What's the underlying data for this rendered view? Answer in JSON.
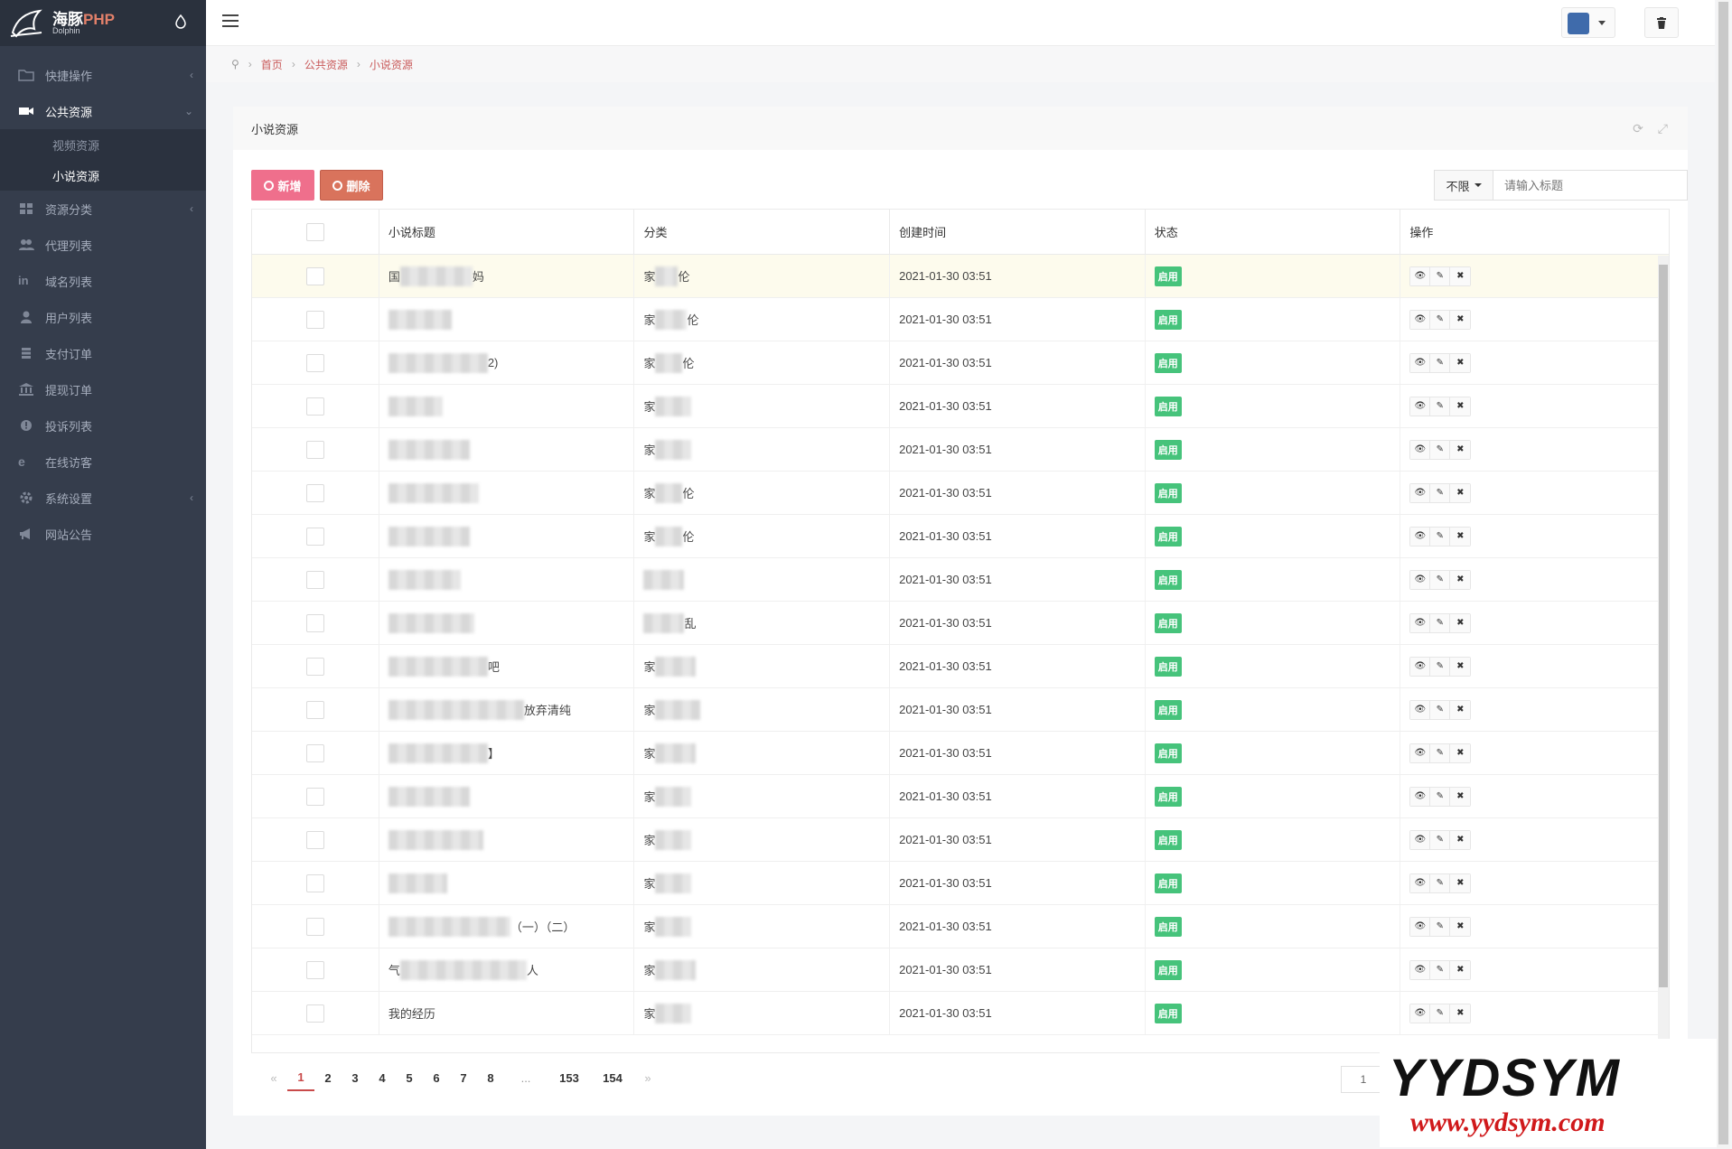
{
  "brand": {
    "name": "海豚",
    "name_suffix": "PHP",
    "sub": "Dolphin"
  },
  "sidebar": {
    "items": [
      {
        "label": "快捷操作",
        "has_arrow": true
      },
      {
        "label": "公共资源",
        "open": true
      },
      {
        "label": "资源分类",
        "has_arrow": true
      },
      {
        "label": "代理列表"
      },
      {
        "label": "域名列表"
      },
      {
        "label": "用户列表"
      },
      {
        "label": "支付订单"
      },
      {
        "label": "提现订单"
      },
      {
        "label": "投诉列表"
      },
      {
        "label": "在线访客"
      },
      {
        "label": "系统设置",
        "has_arrow": true
      },
      {
        "label": "网站公告"
      }
    ],
    "sub_items": [
      {
        "label": "视频资源"
      },
      {
        "label": "小说资源",
        "active": true
      }
    ]
  },
  "breadcrumb": {
    "home": "首页",
    "level1": "公共资源",
    "level2": "小说资源"
  },
  "card": {
    "title": "小说资源",
    "add_label": "新增",
    "delete_label": "删除",
    "filter_label": "不限",
    "search_placeholder": "请输入标题"
  },
  "table": {
    "headers": [
      "小说标题",
      "分类",
      "创建时间",
      "状态",
      "操作"
    ],
    "rows": [
      {
        "title": "国",
        "title_tail": "妈",
        "category": "家",
        "category_tail": "伦",
        "time": "2021-01-30 03:51",
        "status": "启用"
      },
      {
        "title": "",
        "title_tail": "",
        "category": "家",
        "category_tail": "伦",
        "time": "2021-01-30 03:51",
        "status": "启用"
      },
      {
        "title": "",
        "title_tail": "2)",
        "category": "家",
        "category_tail": "伦",
        "time": "2021-01-30 03:51",
        "status": "启用"
      },
      {
        "title": "",
        "title_tail": "",
        "category": "家",
        "category_tail": "",
        "time": "2021-01-30 03:51",
        "status": "启用"
      },
      {
        "title": "",
        "title_tail": "",
        "category": "家",
        "category_tail": "",
        "time": "2021-01-30 03:51",
        "status": "启用"
      },
      {
        "title": "",
        "title_tail": "",
        "category": "家",
        "category_tail": "伦",
        "time": "2021-01-30 03:51",
        "status": "启用"
      },
      {
        "title": "",
        "title_tail": "",
        "category": "家",
        "category_tail": "伦",
        "time": "2021-01-30 03:51",
        "status": "启用"
      },
      {
        "title": "",
        "title_tail": "",
        "category": "",
        "category_tail": "",
        "time": "2021-01-30 03:51",
        "status": "启用"
      },
      {
        "title": "",
        "title_tail": "",
        "category": "",
        "category_tail": "乱",
        "time": "2021-01-30 03:51",
        "status": "启用"
      },
      {
        "title": "",
        "title_tail": "吧",
        "category": "家",
        "category_tail": "",
        "time": "2021-01-30 03:51",
        "status": "启用"
      },
      {
        "title": "",
        "title_tail": "放弃清纯",
        "category": "家",
        "category_tail": "",
        "time": "2021-01-30 03:51",
        "status": "启用"
      },
      {
        "title": "",
        "title_tail": "】",
        "category": "家",
        "category_tail": "",
        "time": "2021-01-30 03:51",
        "status": "启用"
      },
      {
        "title": "",
        "title_tail": "",
        "category": "家",
        "category_tail": "",
        "time": "2021-01-30 03:51",
        "status": "启用"
      },
      {
        "title": "",
        "title_tail": "",
        "category": "家",
        "category_tail": "",
        "time": "2021-01-30 03:51",
        "status": "启用"
      },
      {
        "title": "",
        "title_tail": "",
        "category": "家",
        "category_tail": "",
        "time": "2021-01-30 03:51",
        "status": "启用"
      },
      {
        "title": "",
        "title_tail": "（一）（二）",
        "category": "家",
        "category_tail": "",
        "time": "2021-01-30 03:51",
        "status": "启用"
      },
      {
        "title": "气",
        "title_tail": "人",
        "category": "家",
        "category_tail": "",
        "time": "2021-01-30 03:51",
        "status": "启用"
      },
      {
        "title": "我的经历",
        "title_tail": "",
        "category": "家",
        "category_tail": "",
        "time": "2021-01-30 03:51",
        "status": "启用"
      }
    ]
  },
  "pagination": {
    "prev": "«",
    "pages": [
      "1",
      "2",
      "3",
      "4",
      "5",
      "6",
      "7",
      "8",
      "...",
      "153",
      "154"
    ],
    "next": "»",
    "current": "1",
    "jump_value": "1"
  },
  "watermark": {
    "big": "YYDSYM",
    "url": "www.yydsym.com"
  },
  "colors": {
    "sidebar": "#353d4c",
    "accent": "#ef6f8c",
    "danger": "#d9735c",
    "success": "#46c37b"
  }
}
